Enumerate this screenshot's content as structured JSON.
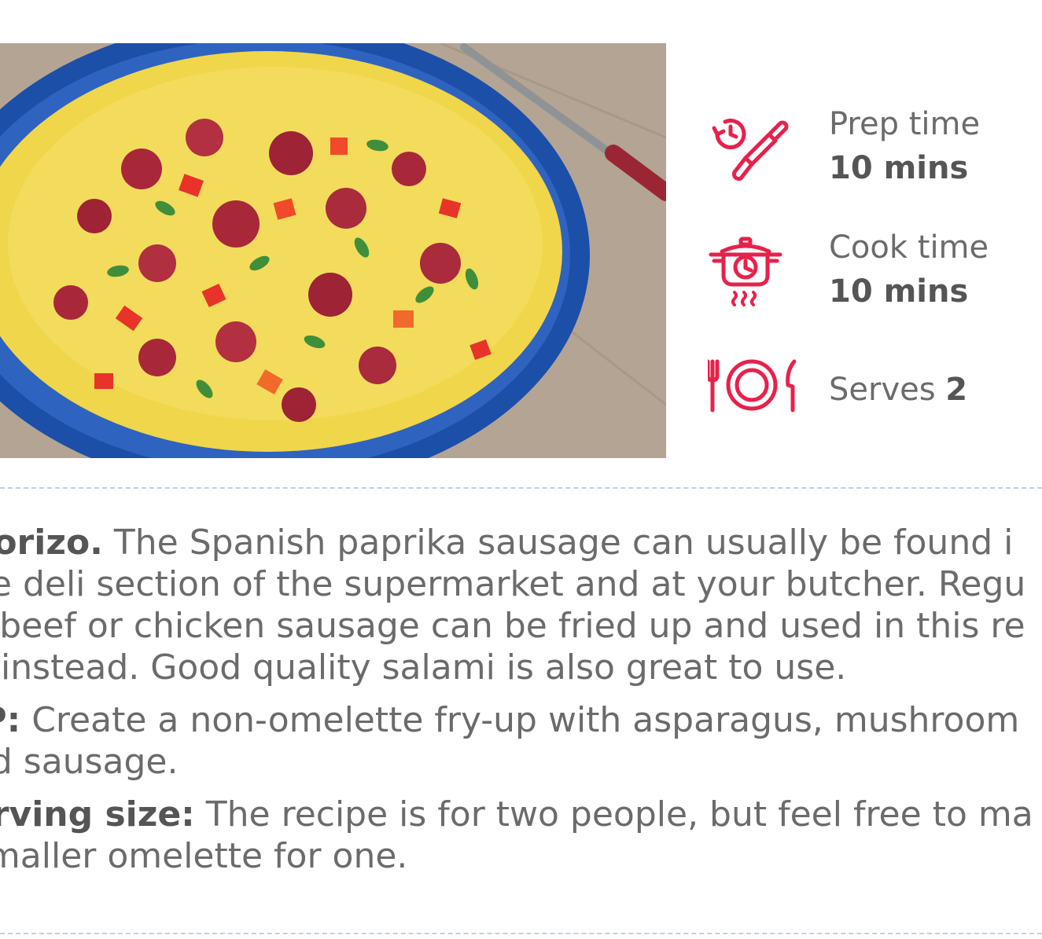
{
  "photo": {
    "alt": "chorizo-omelette-photo"
  },
  "meta": {
    "prep": {
      "label": "Prep time",
      "value": "10 mins",
      "icon": "prep-knife-clock-icon"
    },
    "cook": {
      "label": "Cook time",
      "value": "10 mins",
      "icon": "cooking-pot-timer-icon"
    },
    "serves": {
      "label": "Serves",
      "value": "2",
      "icon": "plate-cutlery-icon"
    },
    "accent_color": "#e8214a"
  },
  "notes": [
    {
      "label": "horizo.",
      "lines": [
        " The Spanish paprika sausage can usually be found i",
        "he deli section of the supermarket and at your butcher. Regu",
        "F beef or chicken sausage can be fried up and used in this re",
        "e instead. Good quality salami is also great to use."
      ]
    },
    {
      "label": "IP:",
      "lines": [
        " Create a non-omelette fry-up with asparagus, mushroom",
        "nd sausage."
      ]
    },
    {
      "label": "erving size:",
      "lines": [
        " The recipe is for two people, but feel free to ma",
        " smaller omelette for one."
      ]
    }
  ]
}
